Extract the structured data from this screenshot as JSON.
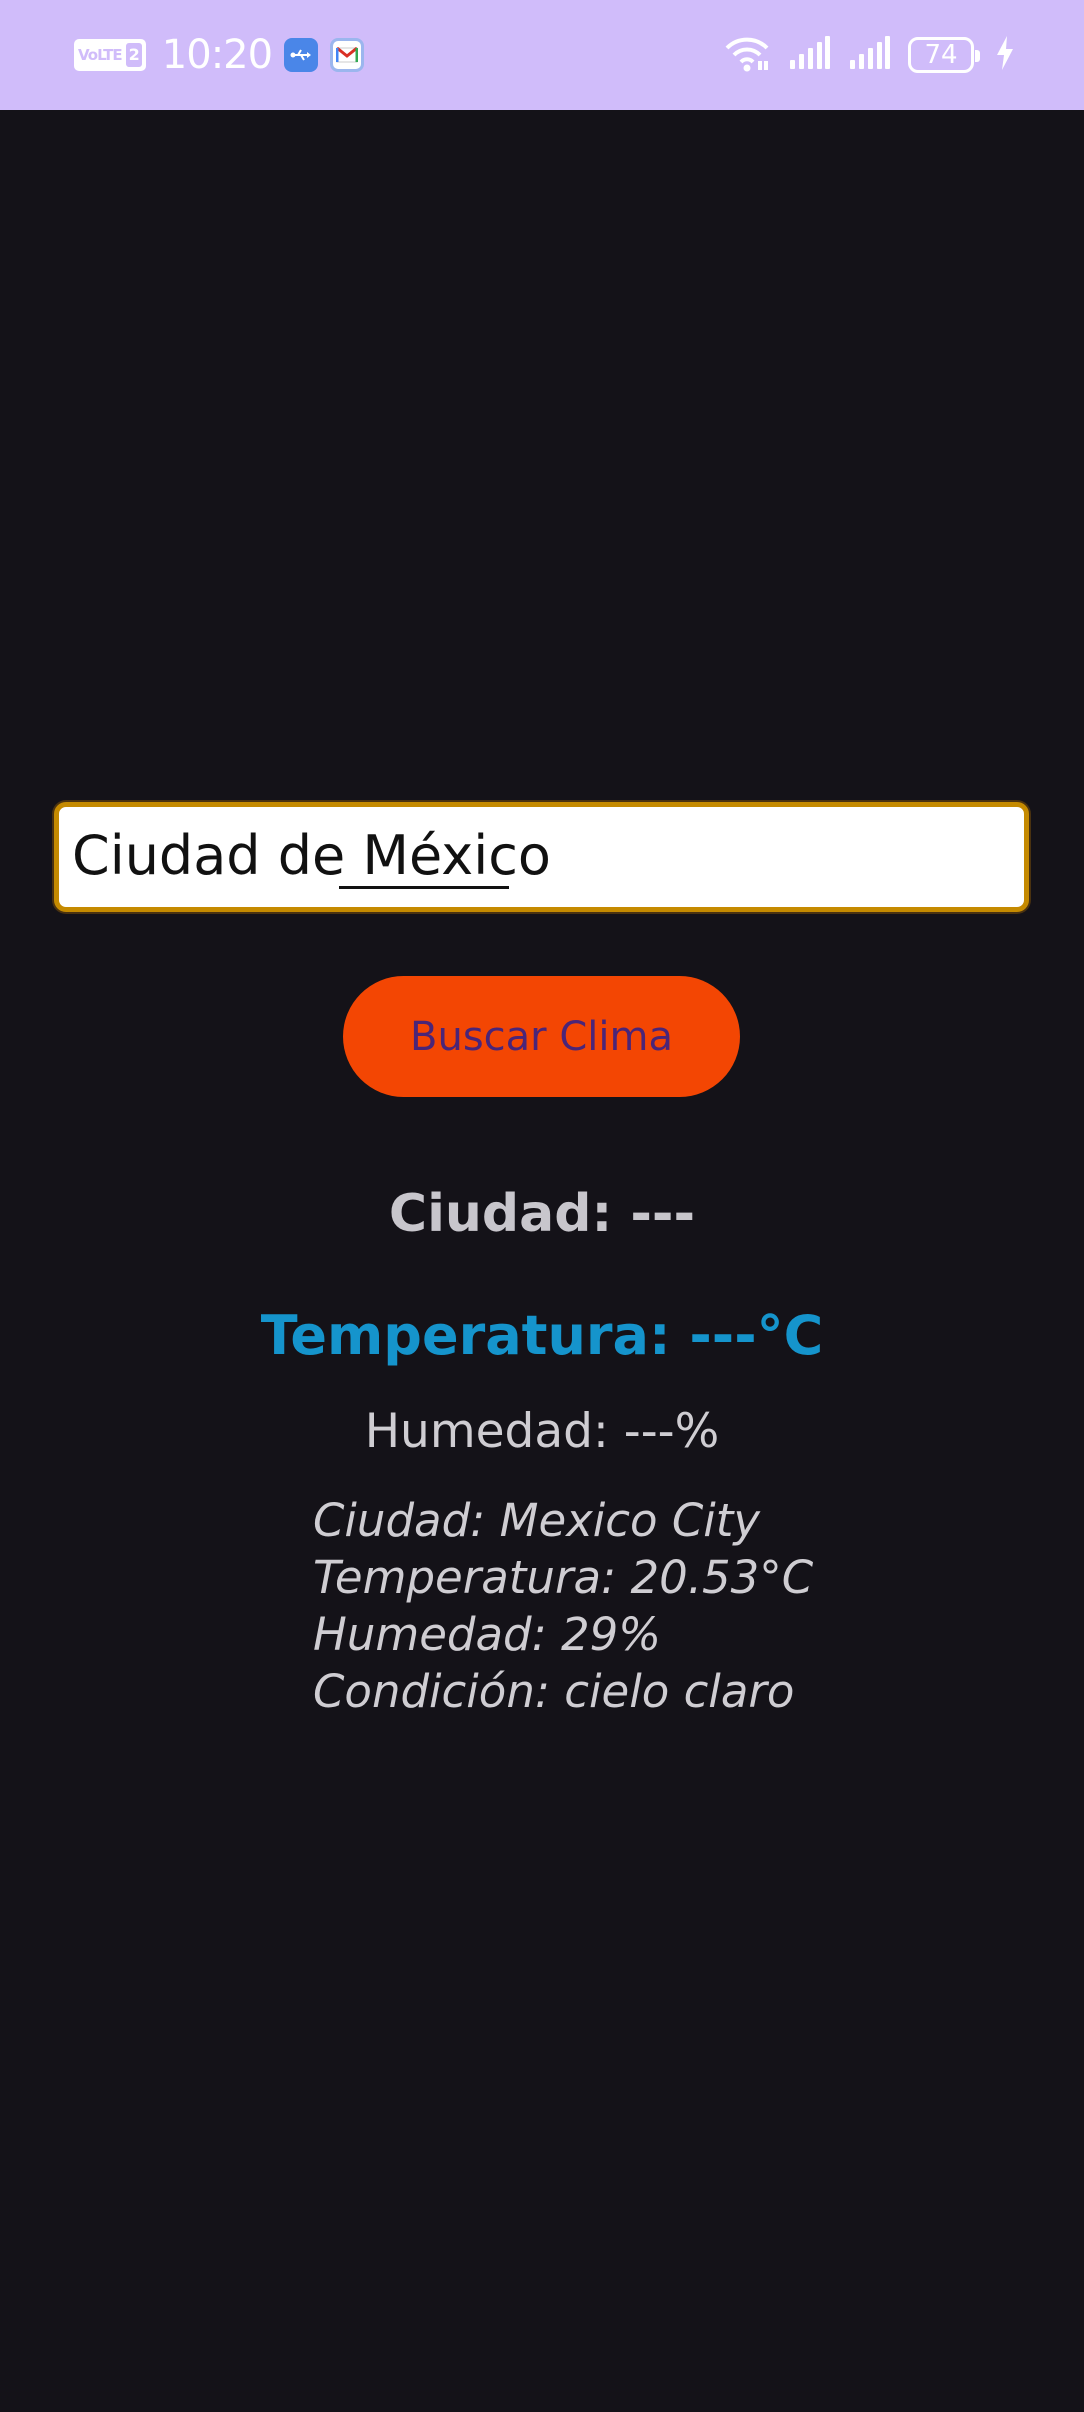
{
  "status_bar": {
    "network_badge": "VoLTE",
    "sim_slot": "2",
    "time": "10:20",
    "battery_level": "74",
    "colors": {
      "background": "#d0bcfa",
      "foreground": "#ffffff"
    },
    "icons": [
      "usb-icon",
      "gmail-icon",
      "wifi-icon",
      "signal-icon",
      "signal-icon",
      "battery-icon",
      "charging-icon"
    ]
  },
  "search": {
    "value": "Ciudad de México"
  },
  "button": {
    "label": "Buscar Clima",
    "color": "#f34603"
  },
  "weather": {
    "city_label": "Ciudad: ---",
    "temperature_label": "Temperatura: ---°C",
    "humidity_label": "Humedad: ---%",
    "result_text": "Ciudad: Mexico City\nTemperatura: 20.53°C\nHumedad: 29%\nCondición: cielo claro"
  },
  "theme": {
    "background": "#141218",
    "accent_temperature": "#1594cc",
    "input_border": "#c58a00"
  }
}
